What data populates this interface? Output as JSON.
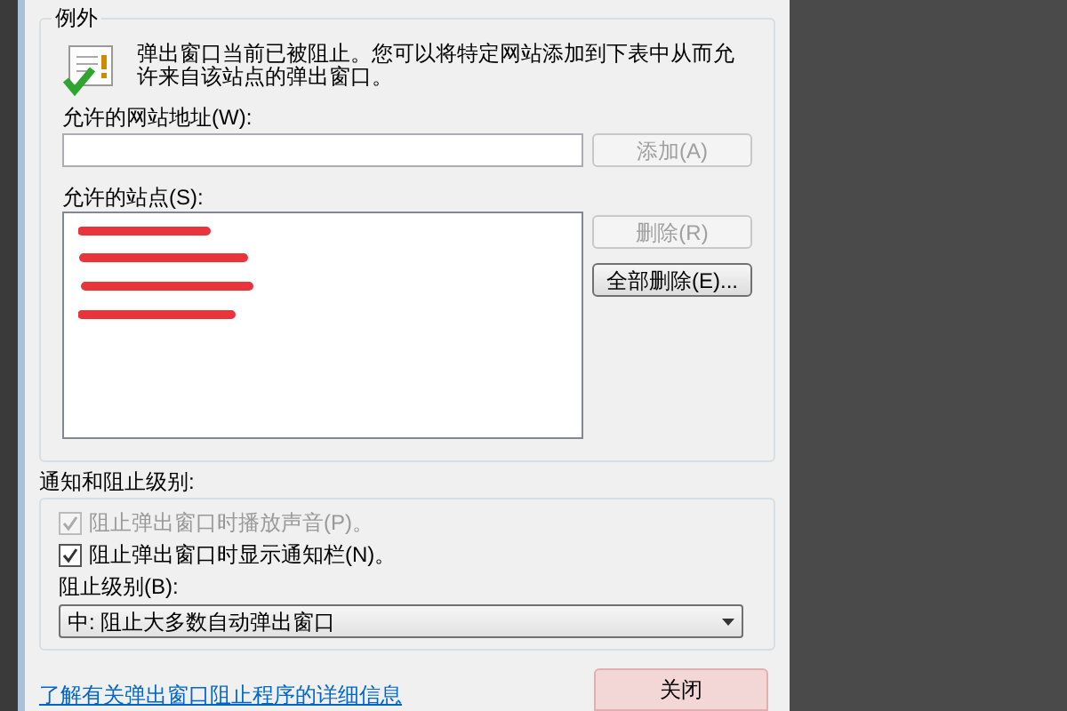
{
  "exceptions": {
    "title": "例外",
    "info": "弹出窗口当前已被阻止。您可以将特定网站添加到下表中从而允许来自该站点的弹出窗口。",
    "address_label": "允许的网站地址(W):",
    "add_button": {
      "label": "添加(A)",
      "disabled": true
    },
    "sites_label": "允许的站点(S):",
    "remove_button": {
      "label": "删除(R)",
      "disabled": true
    },
    "remove_all_button": {
      "label": "全部删除(E)...",
      "disabled": false
    }
  },
  "notifications": {
    "title": "通知和阻止级别:",
    "options": [
      {
        "label": "阻止弹出窗口时播放声音(P)。",
        "checked": true,
        "disabled": true
      },
      {
        "label": "阻止弹出窗口时显示通知栏(N)。",
        "checked": true,
        "disabled": false
      }
    ],
    "level_label": "阻止级别(B):",
    "level_value": "中: 阻止大多数自动弹出窗口"
  },
  "footer": {
    "link": "了解有关弹出窗口阻止程序的详细信息",
    "close_button": "关闭"
  }
}
